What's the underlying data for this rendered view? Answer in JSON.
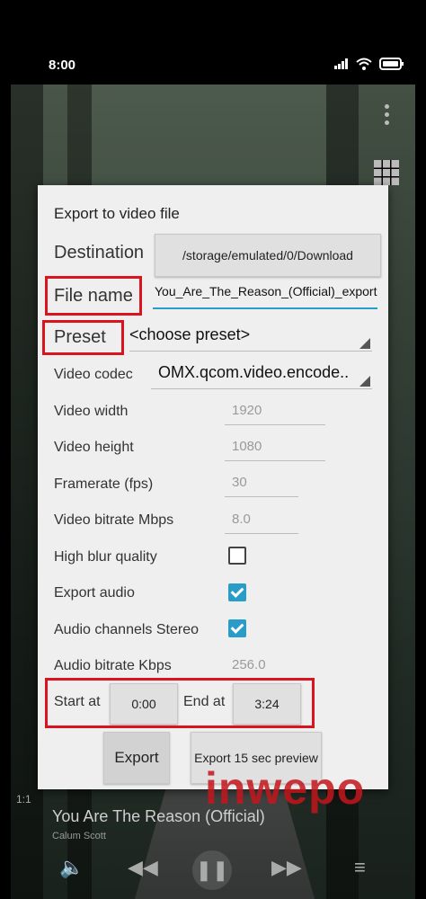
{
  "status": {
    "time": "8:00"
  },
  "dialog": {
    "title": "Export to video file",
    "destination": {
      "label": "Destination",
      "value": "/storage/emulated/0/Download"
    },
    "file_name": {
      "label": "File name",
      "value": "You_Are_The_Reason_(Official)_export"
    },
    "preset": {
      "label": "Preset",
      "value": "<choose preset>"
    },
    "video_codec": {
      "label": "Video codec",
      "value": "OMX.qcom.video.encode.."
    },
    "video_width": {
      "label": "Video width",
      "value": "1920"
    },
    "video_height": {
      "label": "Video height",
      "value": "1080"
    },
    "framerate": {
      "label": "Framerate (fps)",
      "value": "30"
    },
    "video_bitrate": {
      "label": "Video bitrate Mbps",
      "value": "8.0"
    },
    "high_blur": {
      "label": "High blur quality",
      "checked": false
    },
    "export_audio": {
      "label": "Export audio",
      "checked": true
    },
    "audio_stereo": {
      "label": "Audio channels Stereo",
      "checked": true
    },
    "audio_bitrate": {
      "label": "Audio bitrate Kbps",
      "value": "256.0"
    },
    "start_at": {
      "label": "Start at",
      "value": "0:00"
    },
    "end_at": {
      "label": "End at",
      "value": "3:24"
    },
    "export_button": "Export",
    "preview_button": "Export 15 sec preview"
  },
  "background": {
    "track_title": "You Are The Reason (Official)",
    "artist": "Calum Scott",
    "elapsed": "1:1"
  },
  "watermark": "inwepo",
  "colors": {
    "highlight_box": "#d9141e",
    "accent": "#2a9cc8"
  }
}
